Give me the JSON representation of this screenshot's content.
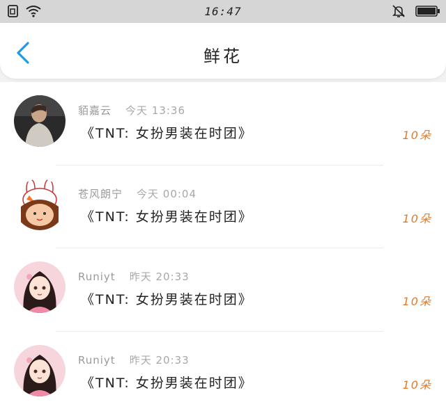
{
  "status_bar": {
    "time": "16:47",
    "icons": [
      "sim-icon",
      "wifi-icon",
      "bell-muted-icon",
      "battery-icon"
    ]
  },
  "header": {
    "title": "鲜花",
    "back_icon": "chevron-left-icon"
  },
  "colors": {
    "accent": "#1e9be6",
    "count": "#e07a2b",
    "status_bar_bg": "#d6d6d6"
  },
  "items": [
    {
      "name": "貊嘉云",
      "time": "今天 13:36",
      "title": "《TNT: 女扮男装在时团》",
      "count": "10朵"
    },
    {
      "name": "苍风朗宁",
      "time": "今天 00:04",
      "title": "《TNT: 女扮男装在时团》",
      "count": "10朵"
    },
    {
      "name": "Runiyt",
      "time": "昨天 20:33",
      "title": "《TNT: 女扮男装在时团》",
      "count": "10朵"
    },
    {
      "name": "Runiyt",
      "time": "昨天 20:33",
      "title": "《TNT: 女扮男装在时团》",
      "count": "10朵"
    }
  ]
}
